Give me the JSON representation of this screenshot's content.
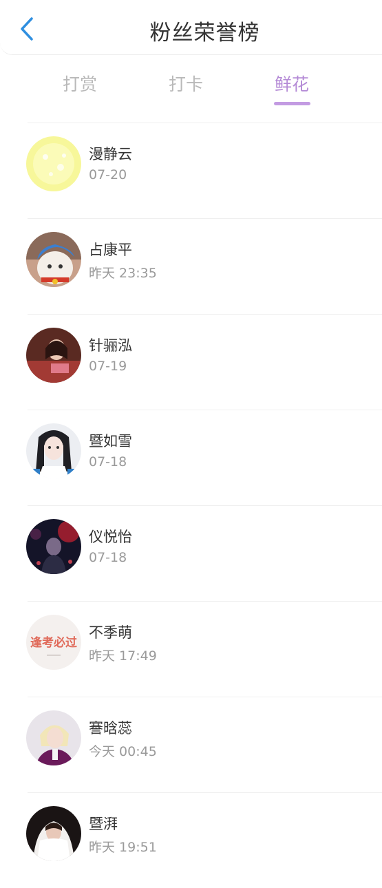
{
  "header": {
    "title": "粉丝荣誉榜",
    "back_icon": "chevron-left-icon",
    "accent_color": "#2f8fe0"
  },
  "tabs": [
    {
      "label": "打赏",
      "active": false
    },
    {
      "label": "打卡",
      "active": false
    },
    {
      "label": "鲜花",
      "active": true
    }
  ],
  "tab_active_color": "#b48ad6",
  "fans": [
    {
      "name": "漫静云",
      "time": "07-20"
    },
    {
      "name": "占康平",
      "time": "昨天 23:35"
    },
    {
      "name": "针骊泓",
      "time": "07-19"
    },
    {
      "name": "暨如雪",
      "time": "07-18"
    },
    {
      "name": "仪悦怡",
      "time": "07-18"
    },
    {
      "name": "不季萌",
      "time": "昨天 17:49"
    },
    {
      "name": "謇晗蕊",
      "time": "今天 00:45"
    },
    {
      "name": "暨湃",
      "time": "昨天 19:51"
    }
  ],
  "avatar_6_text": "逢考必过"
}
